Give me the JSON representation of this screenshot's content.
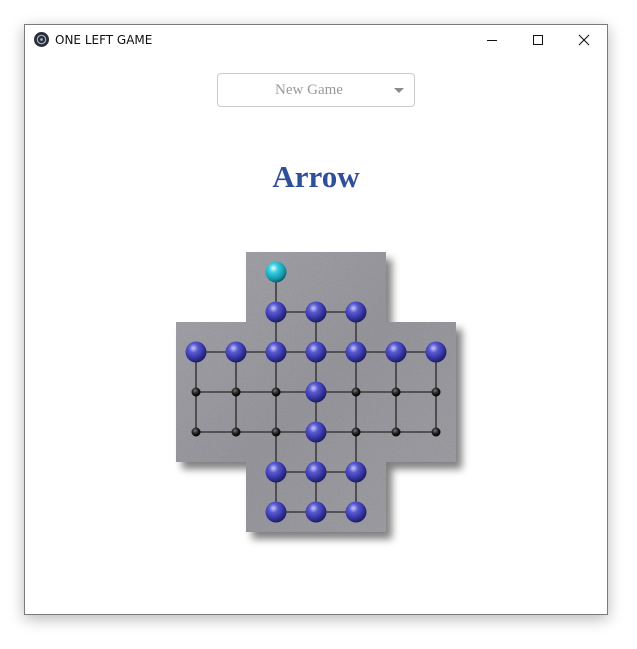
{
  "window": {
    "title": "ONE LEFT GAME",
    "controls": [
      "minimize-icon",
      "maximize-icon",
      "close-icon"
    ]
  },
  "menu": {
    "select_value": "New Game"
  },
  "game": {
    "title": "Arrow",
    "colors": {
      "title": "#2f4f9a",
      "peg": "#3a3aa8",
      "selected_peg": "#1fb3c8",
      "hole": "#222222",
      "board": "#a8a8ae"
    },
    "board": {
      "rows": [
        ". . S . . . .",
        ". . P P P . .",
        "P P P P P P P",
        "O O O P O O O",
        "O O O P O O O",
        ". . P P P . .",
        ". . P P P . ."
      ],
      "legend": {
        "P": "peg",
        "S": "selected peg",
        "O": "empty hole"
      }
    }
  }
}
